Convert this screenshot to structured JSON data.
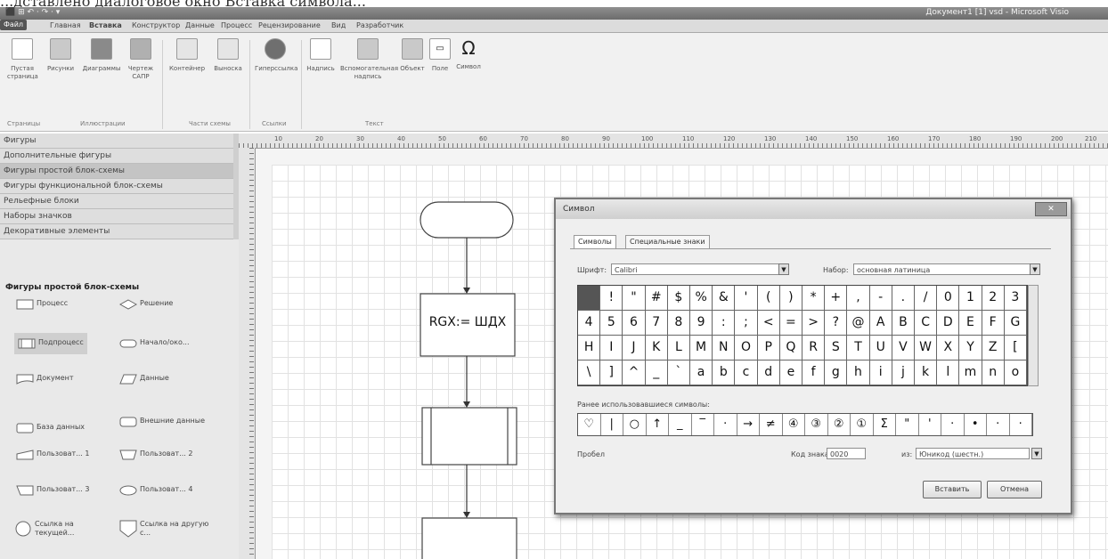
{
  "caption": "...дставлено диалоговое окно Вставка символа...",
  "window": {
    "title": "Документ1 [1] vsd - Microsoft Visio",
    "quick_access": "⬛ ⊞ ↶ · ↷ · ▾"
  },
  "menu_tabs": [
    "Файл",
    "Главная",
    "Вставка",
    "Конструктор",
    "Данные",
    "Процесс",
    "Рецензирование",
    "Вид",
    "Разработчик"
  ],
  "ribbon": {
    "buttons": [
      {
        "label": "Пустая\nстраница"
      },
      {
        "label": "Рисунки"
      },
      {
        "label": "Диаграммы"
      },
      {
        "label": "Чертеж\nСАПР"
      },
      {
        "label": "Контейнер"
      },
      {
        "label": "Выноска"
      },
      {
        "label": "Гиперссылка"
      },
      {
        "label": "Надпись"
      },
      {
        "label": "Вспомогательная\nнадпись"
      },
      {
        "label": "Объект"
      },
      {
        "label": "Поле"
      },
      {
        "label": "Символ"
      }
    ],
    "groups": [
      "Страницы",
      "Иллюстрации",
      "Части схемы",
      "Ссылки",
      "Текст"
    ]
  },
  "shapes_pane": {
    "stencils": [
      "Фигуры",
      "Дополнительные фигуры",
      "Фигуры простой блок-схемы",
      "Фигуры функциональной блок-схемы",
      "Рельефные блоки",
      "Наборы значков",
      "Декоративные элементы"
    ],
    "header": "Фигуры простой блок-схемы",
    "shapes": [
      "Процесс",
      "Решение",
      "Подпроцесс",
      "Начало/око...",
      "Документ",
      "Данные",
      "База данных",
      "Внешние данные",
      "Пользоват... 1",
      "Пользоват... 2",
      "Пользоват... 3",
      "Пользоват... 4",
      "Ссылка на текущей...",
      "Ссылка на другую с..."
    ]
  },
  "ruler": {
    "ticks": [
      "10",
      "20",
      "30",
      "40",
      "50",
      "60",
      "70",
      "80",
      "90",
      "100",
      "110",
      "120",
      "130",
      "140",
      "150",
      "160",
      "170",
      "180",
      "190",
      "200",
      "210"
    ]
  },
  "flowchart": {
    "box_label": "RGX:= ШДХ"
  },
  "symbol_dialog": {
    "title": "Символ",
    "close_label": "✕",
    "tabs": [
      "Символы",
      "Специальные знаки"
    ],
    "font_label": "Шрифт:",
    "font_value": "Calibri",
    "subset_label": "Набор:",
    "subset_value": "основная латиница",
    "grid_rows": [
      [
        " ",
        "!",
        "\"",
        "#",
        "$",
        "%",
        "&",
        "'",
        "(",
        ")",
        "*",
        "+",
        ",",
        "-",
        ".",
        "/",
        "0",
        "1",
        "2",
        "3"
      ],
      [
        "4",
        "5",
        "6",
        "7",
        "8",
        "9",
        ":",
        ";",
        "<",
        "=",
        ">",
        "?",
        "@",
        "A",
        "B",
        "C",
        "D",
        "E",
        "F",
        "G"
      ],
      [
        "H",
        "I",
        "J",
        "K",
        "L",
        "M",
        "N",
        "O",
        "P",
        "Q",
        "R",
        "S",
        "T",
        "U",
        "V",
        "W",
        "X",
        "Y",
        "Z",
        "["
      ],
      [
        "\\",
        "]",
        "^",
        "_",
        "`",
        "a",
        "b",
        "c",
        "d",
        "e",
        "f",
        "g",
        "h",
        "i",
        "j",
        "k",
        "l",
        "m",
        "n",
        "o"
      ]
    ],
    "recent_label": "Ранее использовавшиеся символы:",
    "recent_symbols": [
      "♡",
      "|",
      "○",
      "↑",
      "_",
      "‾",
      "·",
      "→",
      "≠",
      "④",
      "③",
      "②",
      "①",
      "Σ",
      "\"",
      "'",
      "·",
      "•",
      "·",
      "·"
    ],
    "char_name": "Пробел",
    "code_label": "Код знака:",
    "code_value": "0020",
    "from_label": "из:",
    "from_value": "Юникод (шестн.)",
    "insert_button": "Вставить",
    "cancel_button": "Отмена"
  }
}
